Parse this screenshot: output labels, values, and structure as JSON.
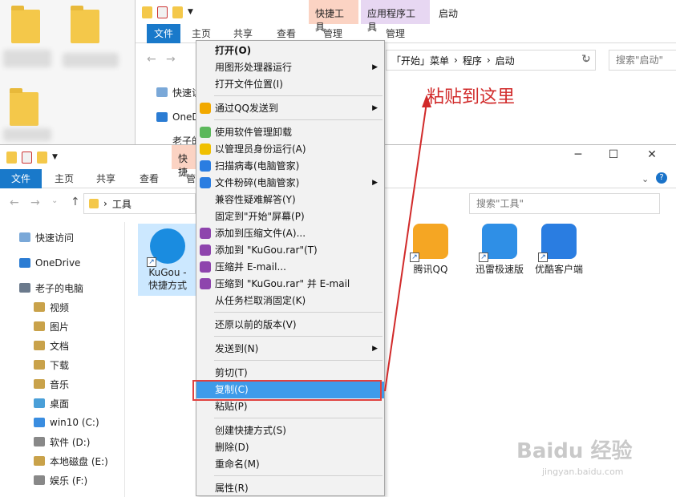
{
  "back_window": {
    "ctx_tab_quick": "快捷工具",
    "ctx_tab_app": "应用程序工具",
    "title": "启动",
    "tabs": [
      "文件",
      "主页",
      "共享",
      "查看",
      "管理",
      "管理"
    ],
    "address": [
      "「开始」菜单",
      "程序",
      "启动"
    ],
    "search_placeholder": "搜索\"启动\"",
    "nav_items": [
      "快速访",
      "OneD",
      "老子的"
    ]
  },
  "front_window": {
    "ctx_tab_quick": "快捷",
    "tabs": [
      "文件",
      "主页",
      "共享",
      "查看",
      "管"
    ],
    "address": "工具",
    "search_placeholder": "搜索\"工具\"",
    "sidebar": [
      {
        "label": "快速访问",
        "icon": "star-icon"
      },
      {
        "label": "OneDrive",
        "icon": "cloud-icon"
      },
      {
        "label": "老子的电脑",
        "icon": "computer-icon"
      },
      {
        "label": "视频",
        "icon": "video-folder-icon"
      },
      {
        "label": "图片",
        "icon": "picture-folder-icon"
      },
      {
        "label": "文档",
        "icon": "document-folder-icon"
      },
      {
        "label": "下载",
        "icon": "download-folder-icon"
      },
      {
        "label": "音乐",
        "icon": "music-folder-icon"
      },
      {
        "label": "桌面",
        "icon": "desktop-folder-icon"
      },
      {
        "label": "win10 (C:)",
        "icon": "windows-drive-icon"
      },
      {
        "label": "软件 (D:)",
        "icon": "drive-icon"
      },
      {
        "label": "本地磁盘 (E:)",
        "icon": "drive-icon"
      },
      {
        "label": "娱乐 (F:)",
        "icon": "drive-icon"
      }
    ],
    "files": [
      {
        "label_line1": "KuGou -",
        "label_line2": "快捷方式",
        "color": "#1a8ce0"
      },
      {
        "label_line1": "腾讯QQ",
        "label_line2": "",
        "color": "#f5a623"
      },
      {
        "label_line1": "迅雷极速版",
        "label_line2": "",
        "color": "#2f8fe6"
      },
      {
        "label_line1": "优酷客户端",
        "label_line2": "",
        "color": "#2a7de1"
      }
    ]
  },
  "context_menu": {
    "items": [
      {
        "label": "打开(O)",
        "bold": true
      },
      {
        "label": "用图形处理器运行",
        "submenu": true
      },
      {
        "label": "打开文件位置(I)"
      },
      {
        "label": "通过QQ发送到",
        "submenu": true,
        "icon": "qq-icon"
      },
      {
        "label": "使用软件管理卸载",
        "icon": "flower-icon"
      },
      {
        "label": "以管理员身份运行(A)",
        "icon": "shield-icon"
      },
      {
        "label": "扫描病毒(电脑管家)",
        "icon": "guard-icon"
      },
      {
        "label": "文件粉碎(电脑管家)",
        "submenu": true,
        "icon": "guard-icon"
      },
      {
        "label": "兼容性疑难解答(Y)"
      },
      {
        "label": "固定到\"开始\"屏幕(P)"
      },
      {
        "label": "添加到压缩文件(A)...",
        "icon": "rar-icon"
      },
      {
        "label": "添加到 \"KuGou.rar\"(T)",
        "icon": "rar-icon"
      },
      {
        "label": "压缩并 E-mail...",
        "icon": "rar-icon"
      },
      {
        "label": "压缩到 \"KuGou.rar\" 并 E-mail",
        "icon": "rar-icon"
      },
      {
        "label": "从任务栏取消固定(K)"
      },
      {
        "label": "还原以前的版本(V)"
      },
      {
        "label": "发送到(N)",
        "submenu": true
      },
      {
        "label": "剪切(T)"
      },
      {
        "label": "复制(C)",
        "highlighted": true
      },
      {
        "label": "粘贴(P)"
      },
      {
        "label": "创建快捷方式(S)"
      },
      {
        "label": "删除(D)"
      },
      {
        "label": "重命名(M)"
      },
      {
        "label": "属性(R)"
      }
    ]
  },
  "annotation": "粘贴到这里",
  "watermark": {
    "main": "Baidu 经验",
    "sub": "jingyan.baidu.com"
  },
  "colors": {
    "accent": "#1979ca",
    "highlight": "#3e9bea",
    "annotation": "#d12a2a",
    "context_tab": "#fbd3c3",
    "context_tab_app": "#e7d7f2"
  }
}
